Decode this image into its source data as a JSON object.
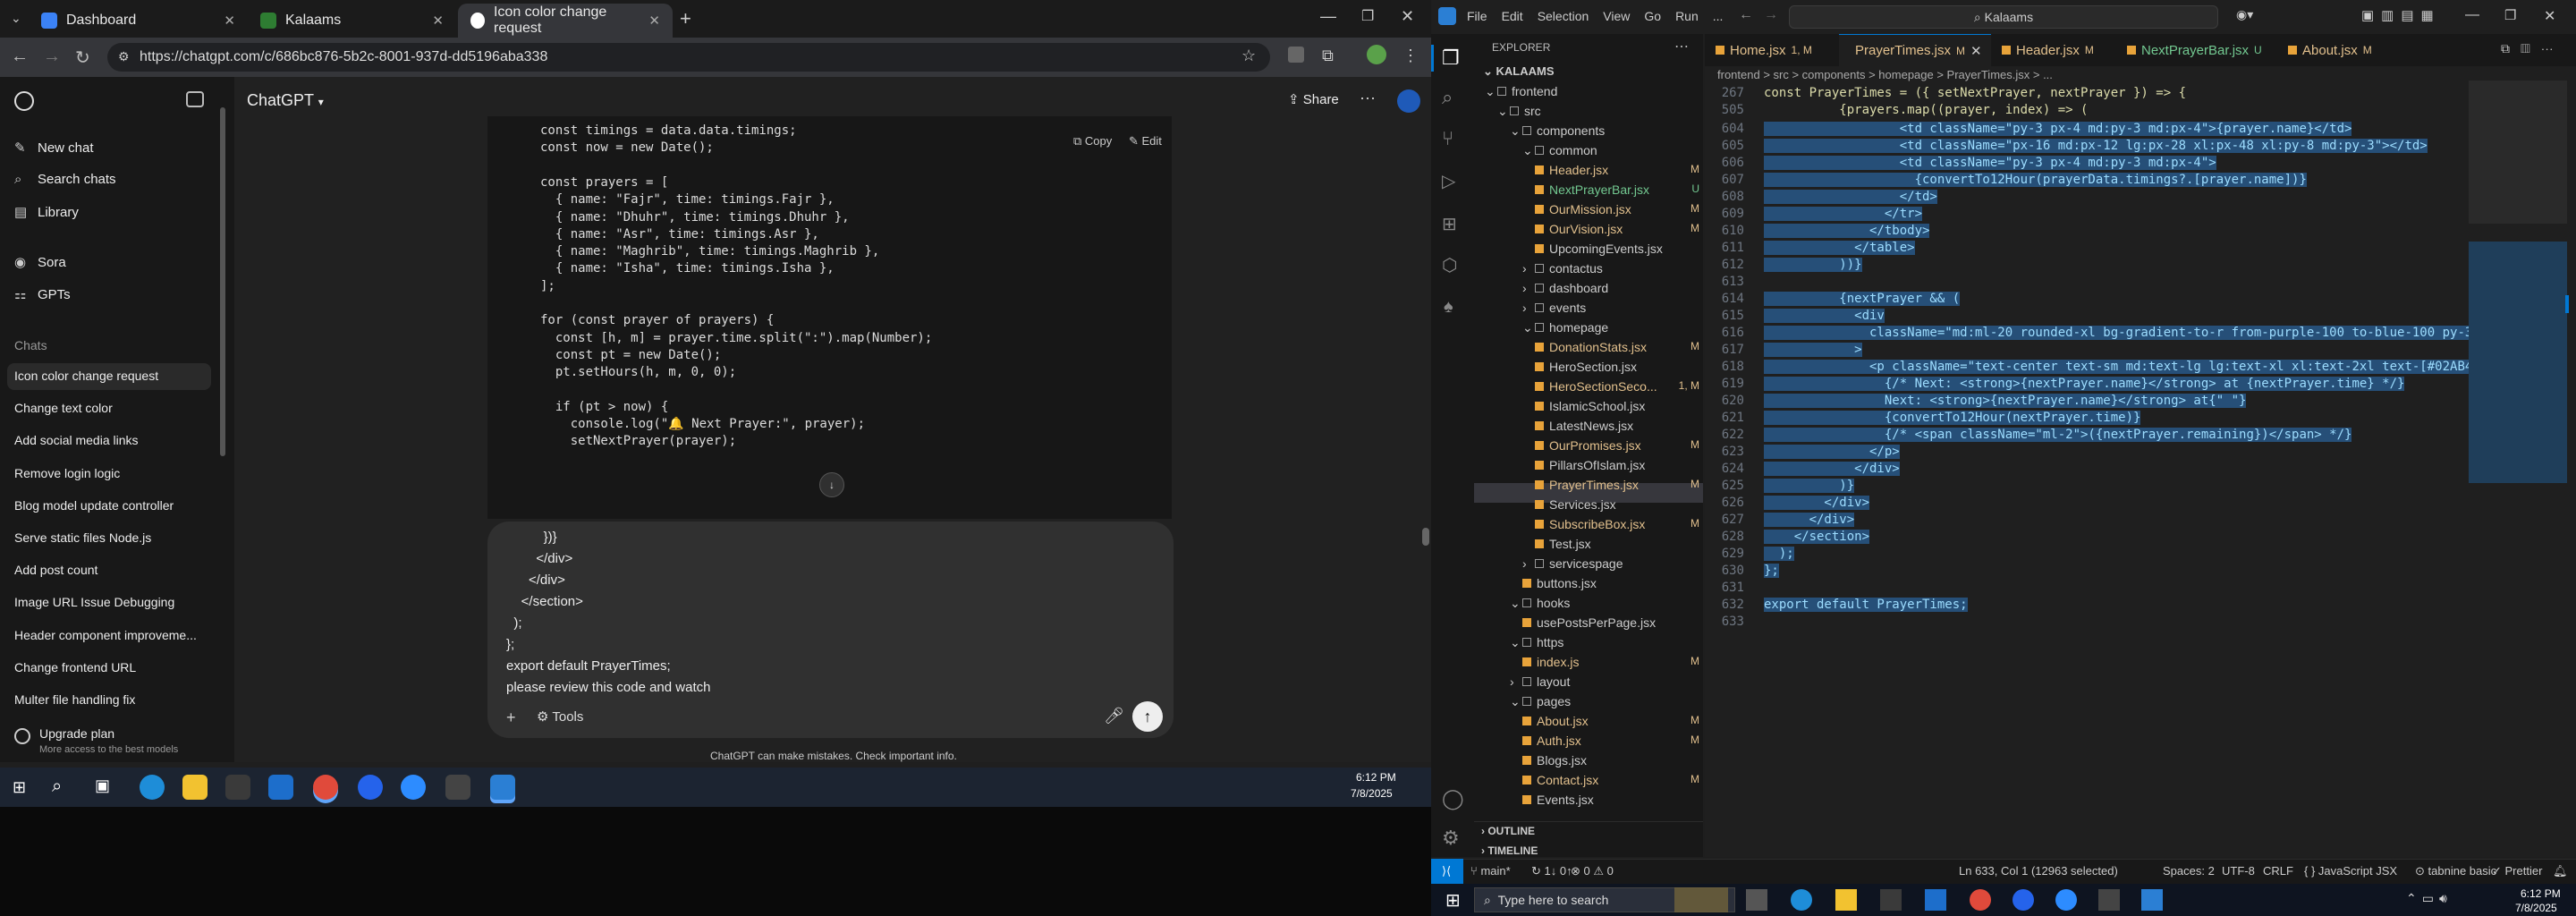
{
  "browser": {
    "tabs": [
      {
        "title": "Dashboard"
      },
      {
        "title": "Kalaams"
      },
      {
        "title": "Icon color change request"
      }
    ],
    "url": "https://chatgpt.com/c/686bc876-5b2c-8001-937d-dd5196aba338"
  },
  "chatgpt": {
    "model_label": "ChatGPT",
    "share_label": "Share",
    "side_top": [
      "New chat",
      "Search chats",
      "Library"
    ],
    "side_apps": [
      "Sora",
      "GPTs"
    ],
    "chats_header": "Chats",
    "chats": [
      "Icon color change request",
      "Change text color",
      "Add social media links",
      "Remove login logic",
      "Blog model update controller",
      "Serve static files Node.js",
      "Add post count",
      "Image URL Issue Debugging",
      "Header component improveme...",
      "Change frontend URL",
      "Multer file handling fix"
    ],
    "upgrade_title": "Upgrade plan",
    "upgrade_sub": "More access to the best models",
    "copy_label": "Copy",
    "edit_label": "Edit",
    "tools_label": "Tools",
    "disclaimer": "ChatGPT can make mistakes. Check important info.",
    "code_lines": [
      "const timings = data.data.timings;",
      "const now = new Date();",
      "",
      "const prayers = [",
      "  { name: \"Fajr\", time: timings.Fajr },",
      "  { name: \"Dhuhr\", time: timings.Dhuhr },",
      "  { name: \"Asr\", time: timings.Asr },",
      "  { name: \"Maghrib\", time: timings.Maghrib },",
      "  { name: \"Isha\", time: timings.Isha },",
      "];",
      "",
      "for (const prayer of prayers) {",
      "  const [h, m] = prayer.time.split(\":\").map(Number);",
      "  const pt = new Date();",
      "  pt.setHours(h, m, 0, 0);",
      "",
      "  if (pt > now) {",
      "    console.log(\"🔔 Next Prayer:\", prayer);",
      "    setNextPrayer(prayer);"
    ],
    "composer_lines": [
      "          })}",
      "        </div>",
      "      </div>",
      "    </section>",
      "  );",
      "};",
      "export default PrayerTimes;",
      "please review this code and watch"
    ]
  },
  "taskbar_left": {
    "time": "6:12 PM",
    "date": "7/8/2025"
  },
  "vscode": {
    "search_text": "Kalaams",
    "menu": [
      "File",
      "Edit",
      "Selection",
      "View",
      "Go",
      "Run",
      "..."
    ],
    "explorer_title": "EXPLORER",
    "project": "KALAAMS",
    "tree": [
      {
        "name": "frontend",
        "depth": 0,
        "type": "folder",
        "open": true,
        "badge": "",
        "color": "#cccccc"
      },
      {
        "name": "src",
        "depth": 1,
        "type": "folder",
        "open": true,
        "badge": "",
        "color": "#cccccc"
      },
      {
        "name": "components",
        "depth": 2,
        "type": "folder",
        "open": true,
        "badge": "",
        "color": "#cccccc"
      },
      {
        "name": "common",
        "depth": 3,
        "type": "folder",
        "open": true,
        "badge": "",
        "color": "#cccccc"
      },
      {
        "name": "Header.jsx",
        "depth": 4,
        "type": "file",
        "badge": "M",
        "color": "#e2c08d"
      },
      {
        "name": "NextPrayerBar.jsx",
        "depth": 4,
        "type": "file",
        "badge": "U",
        "color": "#73c991"
      },
      {
        "name": "OurMission.jsx",
        "depth": 4,
        "type": "file",
        "badge": "M",
        "color": "#e2c08d"
      },
      {
        "name": "OurVision.jsx",
        "depth": 4,
        "type": "file",
        "badge": "M",
        "color": "#e2c08d"
      },
      {
        "name": "UpcomingEvents.jsx",
        "depth": 4,
        "type": "file",
        "badge": "",
        "color": "#cccccc"
      },
      {
        "name": "contactus",
        "depth": 3,
        "type": "folder",
        "open": false,
        "badge": "",
        "color": "#cccccc"
      },
      {
        "name": "dashboard",
        "depth": 3,
        "type": "folder",
        "open": false,
        "badge": "",
        "color": "#cccccc"
      },
      {
        "name": "events",
        "depth": 3,
        "type": "folder",
        "open": false,
        "badge": "",
        "color": "#cccccc"
      },
      {
        "name": "homepage",
        "depth": 3,
        "type": "folder",
        "open": true,
        "badge": "",
        "color": "#cccccc"
      },
      {
        "name": "DonationStats.jsx",
        "depth": 4,
        "type": "file",
        "badge": "M",
        "color": "#e2c08d"
      },
      {
        "name": "HeroSection.jsx",
        "depth": 4,
        "type": "file",
        "badge": "",
        "color": "#cccccc"
      },
      {
        "name": "HeroSectionSeco...",
        "depth": 4,
        "type": "file",
        "badge": "1, M",
        "color": "#e2c08d"
      },
      {
        "name": "IslamicSchool.jsx",
        "depth": 4,
        "type": "file",
        "badge": "",
        "color": "#cccccc"
      },
      {
        "name": "LatestNews.jsx",
        "depth": 4,
        "type": "file",
        "badge": "",
        "color": "#cccccc"
      },
      {
        "name": "OurPromises.jsx",
        "depth": 4,
        "type": "file",
        "badge": "M",
        "color": "#e2c08d"
      },
      {
        "name": "PillarsOfIslam.jsx",
        "depth": 4,
        "type": "file",
        "badge": "",
        "color": "#cccccc"
      },
      {
        "name": "PrayerTimes.jsx",
        "depth": 4,
        "type": "file",
        "badge": "M",
        "color": "#e2c08d",
        "selected": true
      },
      {
        "name": "Services.jsx",
        "depth": 4,
        "type": "file",
        "badge": "",
        "color": "#cccccc"
      },
      {
        "name": "SubscribeBox.jsx",
        "depth": 4,
        "type": "file",
        "badge": "M",
        "color": "#e2c08d"
      },
      {
        "name": "Test.jsx",
        "depth": 4,
        "type": "file",
        "badge": "",
        "color": "#cccccc"
      },
      {
        "name": "servicespage",
        "depth": 3,
        "type": "folder",
        "open": false,
        "badge": "",
        "color": "#cccccc"
      },
      {
        "name": "buttons.jsx",
        "depth": 3,
        "type": "file",
        "badge": "",
        "color": "#cccccc"
      },
      {
        "name": "hooks",
        "depth": 2,
        "type": "folder",
        "open": true,
        "badge": "",
        "color": "#cccccc"
      },
      {
        "name": "usePostsPerPage.jsx",
        "depth": 3,
        "type": "file",
        "badge": "",
        "color": "#cccccc"
      },
      {
        "name": "https",
        "depth": 2,
        "type": "folder",
        "open": true,
        "badge": "",
        "color": "#cccccc"
      },
      {
        "name": "index.js",
        "depth": 3,
        "type": "file",
        "badge": "M",
        "color": "#e2c08d"
      },
      {
        "name": "layout",
        "depth": 2,
        "type": "folder",
        "open": false,
        "badge": "",
        "color": "#cccccc"
      },
      {
        "name": "pages",
        "depth": 2,
        "type": "folder",
        "open": true,
        "badge": "",
        "color": "#cccccc"
      },
      {
        "name": "About.jsx",
        "depth": 3,
        "type": "file",
        "badge": "M",
        "color": "#e2c08d"
      },
      {
        "name": "Auth.jsx",
        "depth": 3,
        "type": "file",
        "badge": "M",
        "color": "#e2c08d"
      },
      {
        "name": "Blogs.jsx",
        "depth": 3,
        "type": "file",
        "badge": "",
        "color": "#cccccc"
      },
      {
        "name": "Contact.jsx",
        "depth": 3,
        "type": "file",
        "badge": "M",
        "color": "#e2c08d"
      },
      {
        "name": "Events.jsx",
        "depth": 3,
        "type": "file",
        "badge": "",
        "color": "#cccccc"
      }
    ],
    "outline_label": "OUTLINE",
    "timeline_label": "TIMELINE",
    "tabs": [
      {
        "name": "Home.jsx",
        "badge": "1, M",
        "color": "#e2c08d"
      },
      {
        "name": "PrayerTimes.jsx",
        "badge": "M",
        "color": "#e2c08d",
        "active": true
      },
      {
        "name": "Header.jsx",
        "badge": "M",
        "color": "#e2c08d"
      },
      {
        "name": "NextPrayerBar.jsx",
        "badge": "U",
        "color": "#73c991"
      },
      {
        "name": "About.jsx",
        "badge": "M",
        "color": "#e2c08d"
      }
    ],
    "breadcrumb": "frontend > src > components > homepage > PrayerTimes.jsx > ...",
    "sticky": [
      {
        "n": "267",
        "t": "const PrayerTimes = ({ setNextPrayer, nextPrayer }) => {"
      },
      {
        "n": "505",
        "t": "          {prayers.map((prayer, index) => ("
      }
    ],
    "lines": [
      {
        "n": "604",
        "t": "                  <td className=\"py-3 px-4 md:py-3 md:px-4\">{prayer.name}</td>"
      },
      {
        "n": "605",
        "t": "                  <td className=\"px-16 md:px-12 lg:px-28 xl:px-48 xl:py-8 md:py-3\"></td>"
      },
      {
        "n": "606",
        "t": "                  <td className=\"py-3 px-4 md:py-3 md:px-4\">"
      },
      {
        "n": "607",
        "t": "                    {convertTo12Hour(prayerData.timings?.[prayer.name])}"
      },
      {
        "n": "608",
        "t": "                  </td>"
      },
      {
        "n": "609",
        "t": "                </tr>"
      },
      {
        "n": "610",
        "t": "              </tbody>"
      },
      {
        "n": "611",
        "t": "            </table>"
      },
      {
        "n": "612",
        "t": "          ))}"
      },
      {
        "n": "613",
        "t": ""
      },
      {
        "n": "614",
        "t": "          {nextPrayer && ("
      },
      {
        "n": "615",
        "t": "            <div"
      },
      {
        "n": "616",
        "t": "              className=\"md:ml-20 rounded-xl bg-gradient-to-r from-purple-100 to-blue-100 py-3 px"
      },
      {
        "n": "617",
        "t": "            >"
      },
      {
        "n": "618",
        "t": "              <p className=\"text-center text-sm md:text-lg lg:text-xl xl:text-2xl text-[#02AB45]\">"
      },
      {
        "n": "619",
        "t": "                {/* Next: <strong>{nextPrayer.name}</strong> at {nextPrayer.time} */}"
      },
      {
        "n": "620",
        "t": "                Next: <strong>{nextPrayer.name}</strong> at{\" \"}"
      },
      {
        "n": "621",
        "t": "                {convertTo12Hour(nextPrayer.time)}"
      },
      {
        "n": "622",
        "t": "                {/* <span className=\"ml-2\">({nextPrayer.remaining})</span> */}"
      },
      {
        "n": "623",
        "t": "              </p>"
      },
      {
        "n": "624",
        "t": "            </div>"
      },
      {
        "n": "625",
        "t": "          )}"
      },
      {
        "n": "626",
        "t": "        </div>"
      },
      {
        "n": "627",
        "t": "      </div>"
      },
      {
        "n": "628",
        "t": "    </section>"
      },
      {
        "n": "629",
        "t": "  );"
      },
      {
        "n": "630",
        "t": "};"
      },
      {
        "n": "631",
        "t": ""
      },
      {
        "n": "632",
        "t": "export default PrayerTimes;"
      },
      {
        "n": "633",
        "t": ""
      }
    ],
    "status": {
      "branch": "main*",
      "sync": "↻ 1↓ 0↑",
      "problems": "⊗ 0 ⚠ 0",
      "position": "Ln 633, Col 1 (12963 selected)",
      "spaces": "Spaces: 2",
      "encoding": "UTF-8",
      "eol": "CRLF",
      "language": "{ } JavaScript JSX",
      "tabnine": "tabnine basic",
      "prettier": "✓ Prettier"
    }
  },
  "taskbar_right": {
    "search_placeholder": "Type here to search",
    "time": "6:12 PM",
    "date": "7/8/2025"
  }
}
